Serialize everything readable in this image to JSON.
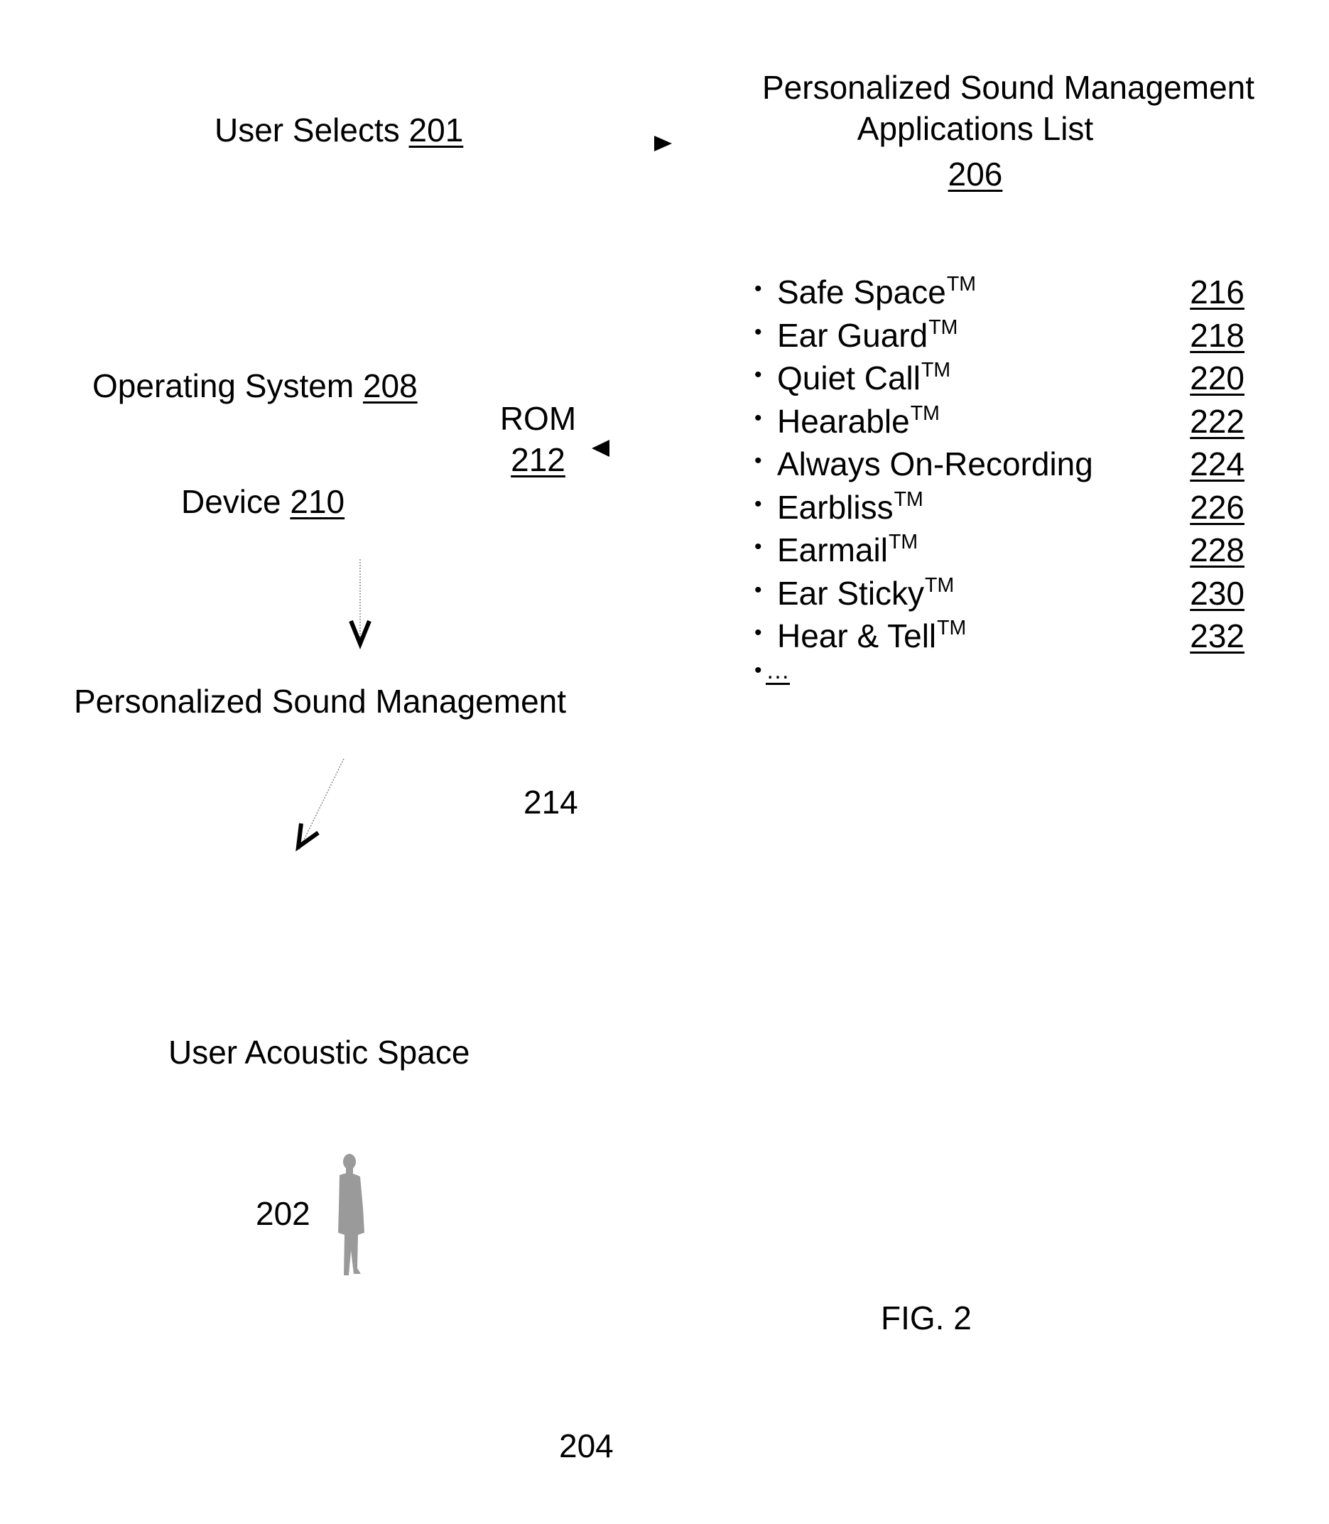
{
  "figure": {
    "label": "FIG. 2",
    "user_selects": {
      "text": "User Selects ",
      "ref": "201"
    },
    "apps_list_title": {
      "line1": "Personalized Sound Management",
      "line2": "Applications List",
      "ref": "206"
    },
    "applications": [
      {
        "name": "Safe Space",
        "tm": "TM",
        "ref": "216",
        "ref_underlined": true
      },
      {
        "name": "Ear Guard",
        "tm": "TM",
        "ref": "218",
        "ref_underlined": true
      },
      {
        "name": "Quiet Call",
        "tm": "TM",
        "ref": "220",
        "ref_underlined": true
      },
      {
        "name": "Hearable",
        "tm": "TM",
        "ref": "222",
        "ref_underlined": true
      },
      {
        "name": "Always On-Recording",
        "tm": "",
        "ref": "224",
        "ref_underlined": true
      },
      {
        "name": "Earbliss",
        "tm": "TM",
        "ref": "226",
        "ref_underlined": true
      },
      {
        "name": "Earmail",
        "tm": "TM",
        "ref": "228",
        "ref_underlined": true
      },
      {
        "name": "Ear Sticky",
        "tm": "TM",
        "ref": "230",
        "ref_underlined": true
      },
      {
        "name": "Hear & Tell",
        "tm": "TM",
        "ref": "232",
        "ref_underlined": true
      }
    ],
    "list_more": "…",
    "bullet": "•",
    "operating_system": {
      "text": "Operating System ",
      "ref": "208"
    },
    "rom": {
      "text": "ROM",
      "ref": "212"
    },
    "device": {
      "text": "Device ",
      "ref": "210"
    },
    "psm_label": "Personalized Sound Management",
    "psm_ref": "214",
    "user_acoustic_space": "User Acoustic Space",
    "user_ref": "202",
    "space_ref": "204",
    "icons": {
      "arrow_to_list": "right-triangle-arrow",
      "arrow_from_list": "left-triangle-arrow",
      "arrow_down": "chevron-down-arrow",
      "arrow_diagonal": "diagonal-arrow",
      "user_figure": "person-silhouette"
    }
  }
}
